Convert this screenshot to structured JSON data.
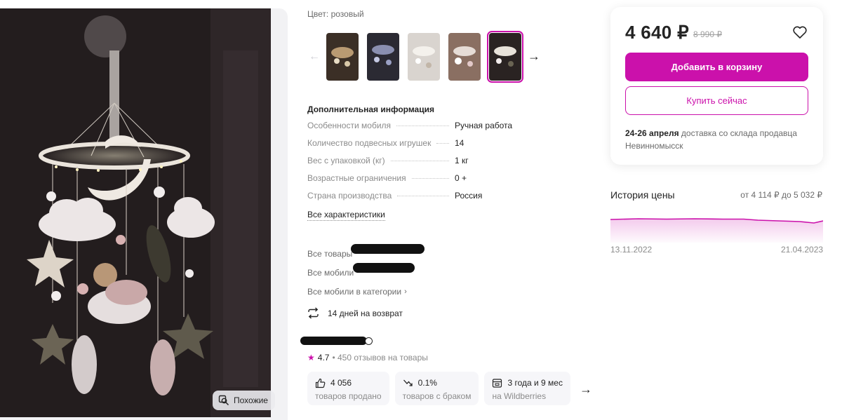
{
  "product": {
    "color_label": "Цвет:",
    "color_value": "розовый",
    "similar_button": "Похожие"
  },
  "additional_info": {
    "title": "Дополнительная информация",
    "specs": [
      {
        "name": "Особенности мобиля",
        "value": "Ручная работа"
      },
      {
        "name": "Количество подвесных игрушек",
        "value": "14"
      },
      {
        "name": "Вес с упаковкой (кг)",
        "value": "1 кг"
      },
      {
        "name": "Возрастные ограничения",
        "value": "0 +"
      },
      {
        "name": "Страна производства",
        "value": "Россия"
      }
    ],
    "all_specs_link": "Все характеристики"
  },
  "links": {
    "all_goods": "Все товары",
    "all_mobiles": "Все мобили",
    "all_mobiles_category": "Все мобили в категории"
  },
  "returns": {
    "text": "14 дней на возврат",
    "icon": "return-arrows-icon"
  },
  "seller": {
    "rating": "4.7",
    "reviews": "• 450 отзывов на товары"
  },
  "stats": [
    {
      "value": "4 056",
      "label": "товаров продано",
      "icon": "thumbs-up-icon"
    },
    {
      "value": "0.1%",
      "label": "товаров с браком",
      "icon": "trend-down-icon"
    },
    {
      "value": "3 года и 9 мес",
      "label": "на Wildberries",
      "icon": "shop-icon"
    }
  ],
  "price_card": {
    "price": "4 640 ₽",
    "old_price": "8 990 ₽",
    "add_to_cart": "Добавить в корзину",
    "buy_now": "Купить сейчас",
    "delivery_dates": "24-26 апреля",
    "delivery_text": "доставка со склада продавца Невинномысск"
  },
  "price_history": {
    "title": "История цены",
    "range": "от 4 114 ₽ до 5 032 ₽",
    "date_start": "13.11.2022",
    "date_end": "21.04.2023",
    "accent_color": "#cb11ab"
  },
  "colors": {
    "brand": "#cb11ab",
    "text": "#242424",
    "muted": "#8b8b8b"
  }
}
